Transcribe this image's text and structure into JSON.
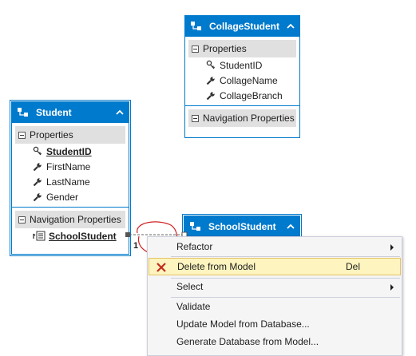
{
  "colors": {
    "entity_header": "#007acc",
    "section_bg": "#e0e0e0",
    "menu_highlight": "#fdf4bf",
    "delete_x": "#c42b1c",
    "annotation": "#d02020"
  },
  "collage_student": {
    "title": "CollageStudent",
    "properties_label": "Properties",
    "properties": [
      "StudentID",
      "CollageName",
      "CollageBranch"
    ],
    "navigation_label": "Navigation Properties"
  },
  "student": {
    "title": "Student",
    "properties_label": "Properties",
    "properties": [
      "StudentID",
      "FirstName",
      "LastName",
      "Gender"
    ],
    "navigation_label": "Navigation Properties",
    "navigation": [
      "SchoolStudent"
    ]
  },
  "school_student": {
    "title": "SchoolStudent"
  },
  "association": {
    "multiplicity": "1"
  },
  "context_menu": {
    "items": [
      {
        "label": "Refactor",
        "submenu": true
      },
      {
        "label": "Delete from Model",
        "shortcut": "Del",
        "icon": "delete-x-icon",
        "highlighted": true
      },
      {
        "label": "Select",
        "submenu": true
      },
      {
        "label": "Validate"
      },
      {
        "label": "Update Model from Database..."
      },
      {
        "label": "Generate Database from Model..."
      }
    ]
  }
}
